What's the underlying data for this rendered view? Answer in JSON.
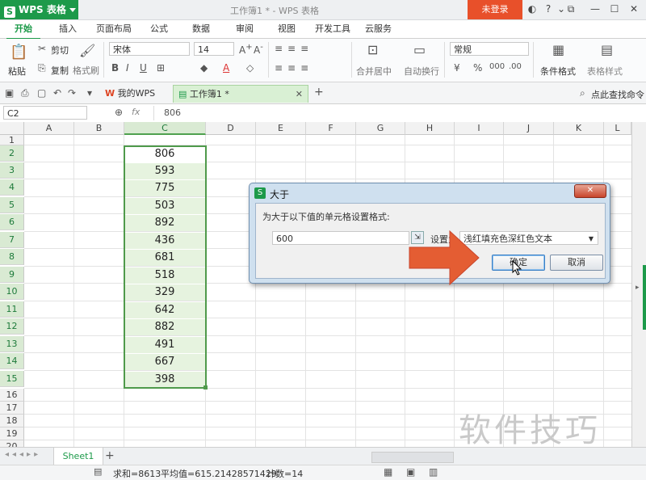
{
  "window": {
    "app_name": "WPS 表格",
    "doc_title": "工作簿1 * - WPS 表格",
    "login_label": "未登录"
  },
  "menu_tabs": [
    "开始",
    "插入",
    "页面布局",
    "公式",
    "数据",
    "审阅",
    "视图",
    "开发工具",
    "云服务"
  ],
  "ribbon": {
    "paste": "粘贴",
    "cut": "剪切",
    "copy": "复制",
    "format_painter": "格式刷",
    "font_name": "宋体",
    "font_size": "14",
    "merge_center": "合并居中",
    "auto_wrap": "自动换行",
    "number_format": "常规",
    "conditional_format": "条件格式",
    "table_style": "表格样式"
  },
  "quickbar": {
    "tab_mywps": "我的WPS",
    "tab_workbook": "工作簿1 *",
    "search": "点此查找命令"
  },
  "formula_bar": {
    "name_box": "C2",
    "fx": "fx",
    "value": "806"
  },
  "grid": {
    "columns": [
      "A",
      "B",
      "C",
      "D",
      "E",
      "F",
      "G",
      "H",
      "I",
      "J",
      "K",
      "L"
    ],
    "rows": [
      "1",
      "2",
      "3",
      "4",
      "5",
      "6",
      "7",
      "8",
      "9",
      "10",
      "11",
      "12",
      "13",
      "14",
      "15",
      "16",
      "17",
      "18",
      "19",
      "20"
    ],
    "c_values": [
      "806",
      "593",
      "775",
      "503",
      "892",
      "436",
      "681",
      "518",
      "329",
      "642",
      "882",
      "491",
      "667",
      "398"
    ]
  },
  "sheet_tab": "Sheet1",
  "status": {
    "sum": "求和=8613",
    "avg": "平均值=615.21428571429",
    "count": "计数=14"
  },
  "dialog": {
    "title": "大于",
    "prompt": "为大于以下值的单元格设置格式:",
    "input_value": "600",
    "set_as_label": "设置为",
    "format_option": "浅红填充色深红色文本",
    "ok": "确定",
    "cancel": "取消"
  },
  "watermark": "软件技巧",
  "colors": {
    "accent": "#1d9a4a",
    "login": "#e8502a",
    "arrow": "#e45d33"
  }
}
